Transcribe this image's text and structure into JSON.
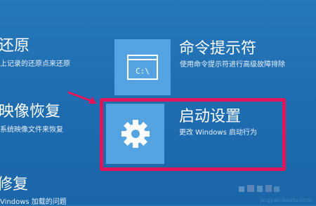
{
  "left_column": {
    "restore_title": "还原",
    "restore_desc": "上记录的还原点来还原",
    "image_title": "映像恢复",
    "image_desc": "系统映像文件来恢复",
    "repair_title": "修复",
    "repair_desc": "Vindows 加载的问题"
  },
  "options": {
    "cmd": {
      "title": "命令提示符",
      "desc": "使用命令提示符进行高级故障排除",
      "icon_text": "C:\\"
    },
    "startup": {
      "title": "启动设置",
      "desc": "更改 Windows 启动行为"
    }
  },
  "watermark": {
    "url": "jingyan.baidu.com"
  },
  "colors": {
    "background": "#1f6fb3",
    "tile": "#56a3e2",
    "highlight": "#e11658"
  }
}
